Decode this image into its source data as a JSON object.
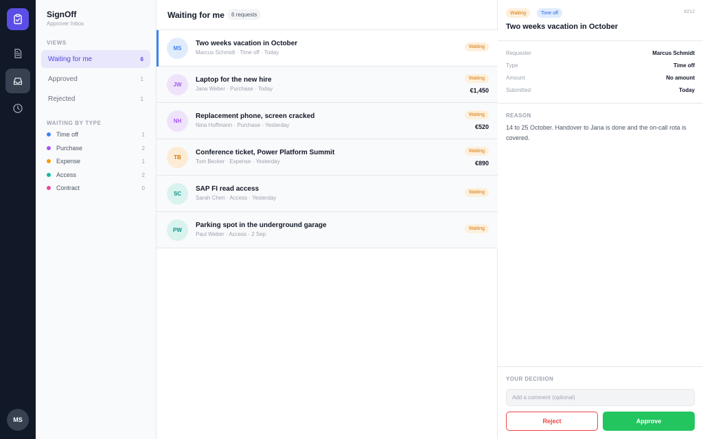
{
  "app": {
    "name": "SignOff",
    "subtitle": "Approver Inbox"
  },
  "rail": {
    "logo_icon": "clipboard-check-icon",
    "items": [
      {
        "icon": "document-icon",
        "active": false
      },
      {
        "icon": "inbox-icon",
        "active": true
      },
      {
        "icon": "clock-icon",
        "active": false
      }
    ],
    "user_initials": "MS"
  },
  "sidebar": {
    "views_label": "VIEWS",
    "views": [
      {
        "label": "Waiting for me",
        "count": "6",
        "active": true
      },
      {
        "label": "Approved",
        "count": "1",
        "active": false
      },
      {
        "label": "Rejected",
        "count": "1",
        "active": false
      }
    ],
    "types_label": "WAITING BY TYPE",
    "types": [
      {
        "label": "Time off",
        "count": "1",
        "color": "#3b82f6"
      },
      {
        "label": "Purchase",
        "count": "2",
        "color": "#a855f7"
      },
      {
        "label": "Expense",
        "count": "1",
        "color": "#f59e0b"
      },
      {
        "label": "Access",
        "count": "2",
        "color": "#14b8a6"
      },
      {
        "label": "Contract",
        "count": "0",
        "color": "#ec4899"
      }
    ]
  },
  "list": {
    "title": "Waiting for me",
    "count_badge": "6 requests",
    "rows": [
      {
        "initials": "MS",
        "title": "Two weeks vacation in October",
        "subtitle": "Marcus Schmidt · Time off · Today",
        "status": "Waiting",
        "amount": "",
        "avatar_bg": "#e0ecfd",
        "avatar_fg": "#3b82f6"
      },
      {
        "initials": "JW",
        "title": "Laptop for the new hire",
        "subtitle": "Jana Weber · Purchase · Today",
        "status": "Waiting",
        "amount": "€1,450",
        "avatar_bg": "#efe3fb",
        "avatar_fg": "#a855f7"
      },
      {
        "initials": "NH",
        "title": "Replacement phone, screen cracked",
        "subtitle": "Nina Hoffmann · Purchase · Yesterday",
        "status": "Waiting",
        "amount": "€520",
        "avatar_bg": "#efe3fb",
        "avatar_fg": "#a855f7"
      },
      {
        "initials": "TB",
        "title": "Conference ticket, Power Platform Summit",
        "subtitle": "Tom Becker · Expense · Yesterday",
        "status": "Waiting",
        "amount": "€890",
        "avatar_bg": "#fcecd6",
        "avatar_fg": "#d97706"
      },
      {
        "initials": "SC",
        "title": "SAP FI read access",
        "subtitle": "Sarah Chen · Access · Yesterday",
        "status": "Waiting",
        "amount": "",
        "avatar_bg": "#d9f3ee",
        "avatar_fg": "#0d9488"
      },
      {
        "initials": "PW",
        "title": "Parking spot in the underground garage",
        "subtitle": "Paul Weber · Access · 2 Sep",
        "status": "Waiting",
        "amount": "",
        "avatar_bg": "#d9f3ee",
        "avatar_fg": "#0d9488"
      }
    ]
  },
  "detail": {
    "status": "Waiting",
    "type": "Time off",
    "id": "#212",
    "title": "Two weeks vacation in October",
    "fields": [
      {
        "label": "Requester",
        "value": "Marcus Schmidt"
      },
      {
        "label": "Type",
        "value": "Time off"
      },
      {
        "label": "Amount",
        "value": "No amount"
      },
      {
        "label": "Submitted",
        "value": "Today"
      }
    ],
    "reason_label": "REASON",
    "reason": "14 to 25 October. Handover to Jana is done and the on-call rota is covered.",
    "decision_label": "YOUR DECISION",
    "comment_placeholder": "Add a comment (optional)",
    "reject_label": "Reject",
    "approve_label": "Approve"
  }
}
